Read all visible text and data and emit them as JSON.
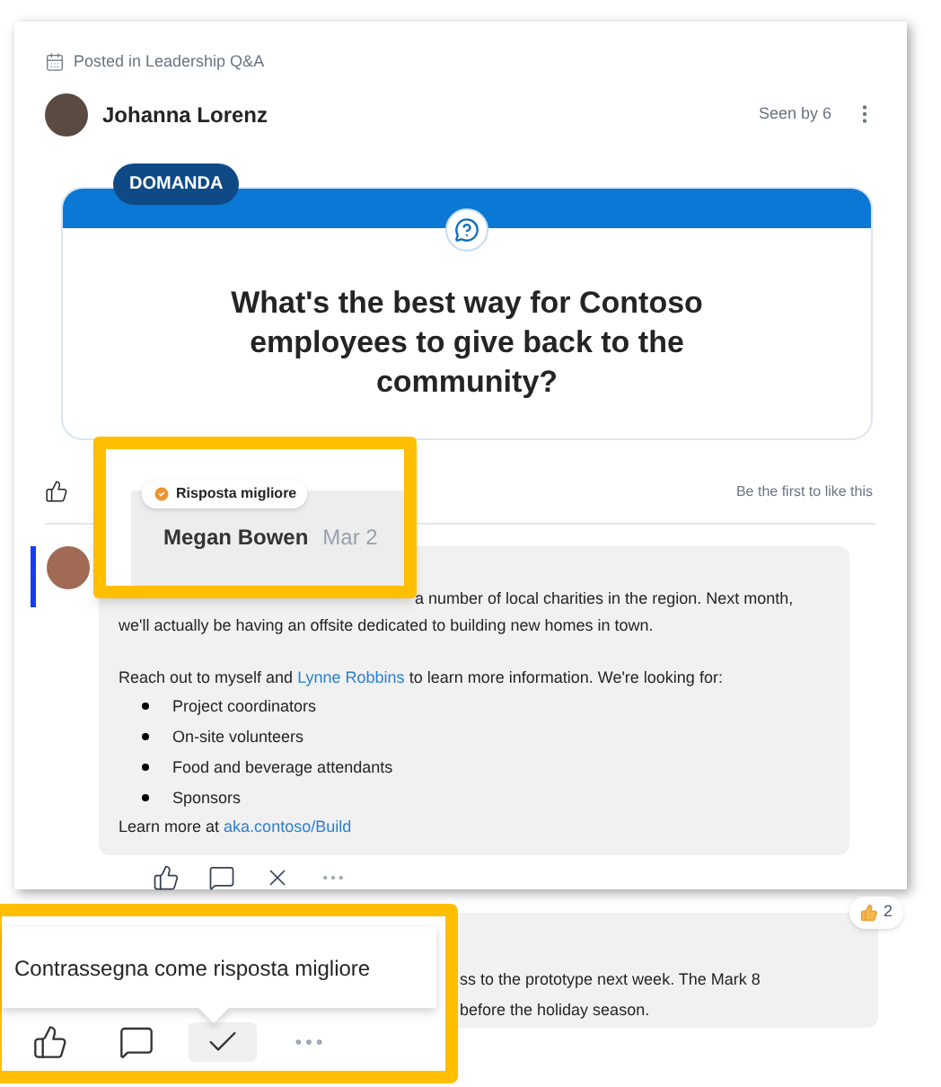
{
  "post": {
    "channel": "Posted in Leadership Q&A",
    "author": "Johanna Lorenz",
    "seen_by": "Seen by 6",
    "badge": "DOMANDA",
    "question": "What's the best way for Contoso employees to give back to the community?"
  },
  "like_row": {
    "status": "Be the first to like this"
  },
  "reply": {
    "best_answer_label": "Risposta migliore",
    "author": "Megan Bowen",
    "date": "Mar 2",
    "paragraph1": "a number of local charities in the region. Next month, we'll actually be having an offsite dedicated to building new homes in town.",
    "paragraph2_before": "Reach out to myself and",
    "paragraph2_link": "Lynne Robbins",
    "paragraph2_after": "to learn more information. We're looking for:",
    "list": [
      "Project coordinators",
      "On-site volunteers",
      "Food and beverage attendants",
      "Sponsors"
    ],
    "learn_more": "Learn more at",
    "learn_more_link": "aka.contoso/Build",
    "actions": [
      {
        "kind": "like"
      },
      {
        "kind": "comment"
      },
      {
        "kind": "close"
      },
      {
        "kind": "more"
      }
    ]
  },
  "second_reply": {
    "lines": [
      "ss to the prototype next week. The Mark 8",
      "before the holiday season."
    ],
    "reaction_count": "2"
  },
  "tooltip": {
    "text": "Contrassegna come risposta migliore"
  },
  "bottom_actions": [
    {
      "kind": "like",
      "selected": false
    },
    {
      "kind": "comment",
      "selected": false
    },
    {
      "kind": "check",
      "selected": true
    },
    {
      "kind": "more",
      "selected": false
    }
  ]
}
